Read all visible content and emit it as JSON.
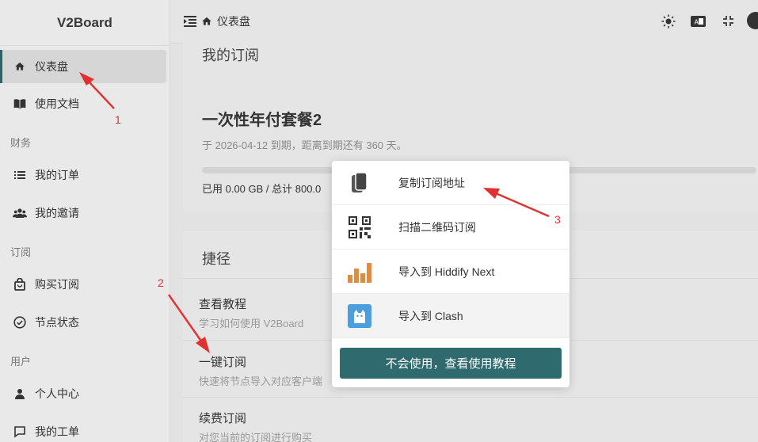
{
  "app": {
    "title": "V2Board"
  },
  "sidebar": {
    "items": [
      {
        "label": "仪表盘",
        "icon": "home-icon"
      },
      {
        "label": "使用文档",
        "icon": "book-icon"
      },
      {
        "label": "我的订单",
        "icon": "list-icon"
      },
      {
        "label": "我的邀请",
        "icon": "users-icon"
      },
      {
        "label": "购买订阅",
        "icon": "shopping-bag-icon"
      },
      {
        "label": "节点状态",
        "icon": "check-circle-icon"
      },
      {
        "label": "个人中心",
        "icon": "user-icon"
      },
      {
        "label": "我的工单",
        "icon": "chat-icon"
      }
    ],
    "sections": {
      "finance": "财务",
      "subscription": "订阅",
      "user": "用户"
    }
  },
  "header": {
    "breadcrumb": "仪表盘",
    "icons": [
      "menu-toggle-icon",
      "home-icon",
      "sun-icon",
      "translate-icon",
      "fullscreen-icon",
      "avatar"
    ]
  },
  "subscription": {
    "title": "我的订阅",
    "plan_name": "一次性年付套餐2",
    "expire_text": "于 2026-04-12 到期，距离到期还有 360 天。",
    "usage_text": "已用 0.00 GB / 总计 800.0",
    "usage_fraction": 0.0
  },
  "shortcuts": {
    "title": "捷径",
    "items": [
      {
        "title": "查看教程",
        "desc": "学习如何使用 V2Board"
      },
      {
        "title": "一键订阅",
        "desc": "快速将节点导入对应客户端"
      },
      {
        "title": "续费订阅",
        "desc": "对您当前的订阅进行购买"
      }
    ]
  },
  "popup": {
    "items": [
      {
        "label": "复制订阅地址",
        "icon": "copy-icon"
      },
      {
        "label": "扫描二维码订阅",
        "icon": "qrcode-icon"
      },
      {
        "label": "导入到 Hiddify Next",
        "icon": "hiddify-icon"
      },
      {
        "label": "导入到 Clash",
        "icon": "clash-icon"
      }
    ],
    "button_label": "不会使用，查看使用教程"
  },
  "annotations": [
    "1",
    "2",
    "3"
  ],
  "colors": {
    "accent": "#2f6a6f",
    "annotation": "#e03131"
  }
}
